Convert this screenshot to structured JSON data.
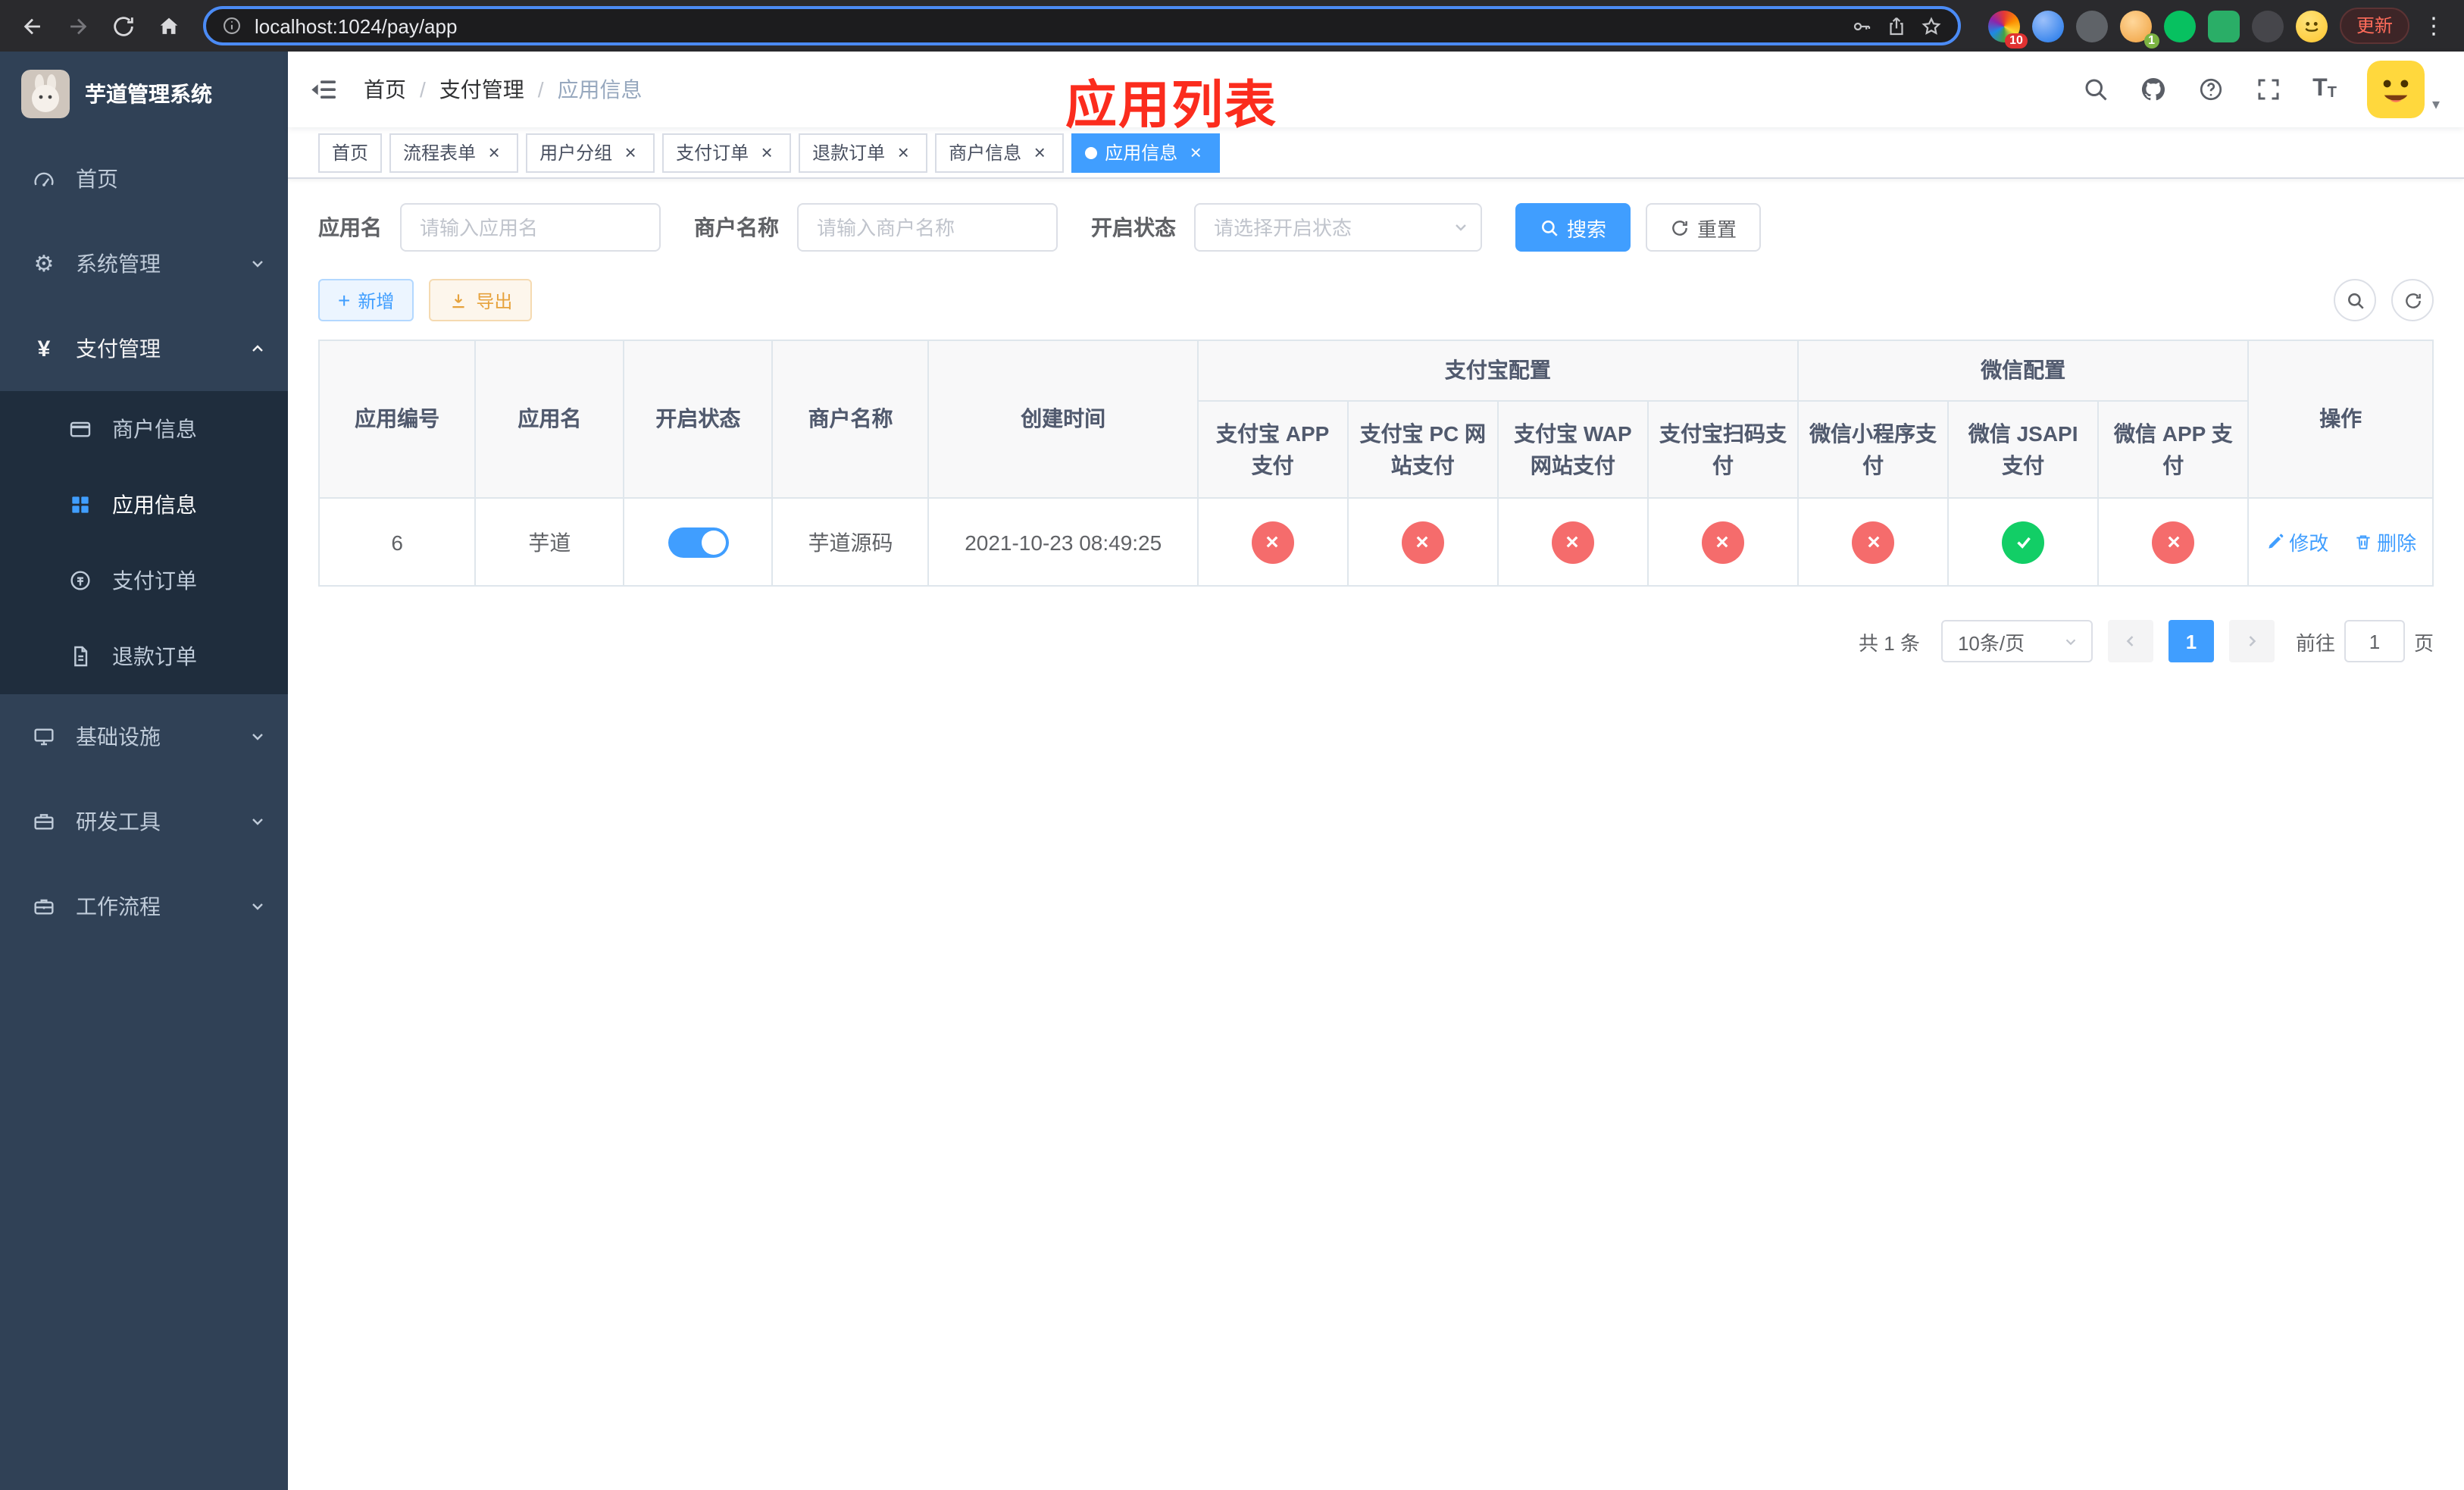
{
  "colors": {
    "primary": "#409eff",
    "success": "#12ce66",
    "danger": "#f56c6c",
    "warning": "#e6a23c",
    "sidebar_bg": "#304156",
    "submenu_bg": "#1f2d3d",
    "title_red": "#fb2c1d"
  },
  "icons": {
    "close": "×",
    "gear": "⚙",
    "yen": "¥",
    "plus": "+",
    "kebab": "⋮",
    "caret": "▾",
    "font_large": "T",
    "font_small": "T"
  },
  "browser": {
    "url": "localhost:1024/pay/app",
    "update_label": "更新",
    "ext_badge_notifications": "10",
    "ext_badge_avatar": "1"
  },
  "sidebar": {
    "title": "芋道管理系统",
    "items": {
      "home": "首页",
      "system": "系统管理",
      "payment": "支付管理",
      "infra": "基础设施",
      "devtools": "研发工具",
      "workflow": "工作流程"
    },
    "payment_children": {
      "merchant": "商户信息",
      "app": "应用信息",
      "order": "支付订单",
      "refund": "退款订单"
    }
  },
  "navbar": {
    "breadcrumb": [
      "首页",
      "支付管理",
      "应用信息"
    ],
    "separator": "/"
  },
  "page_title": "应用列表",
  "tags": [
    {
      "label": "首页",
      "closable": false,
      "active": false
    },
    {
      "label": "流程表单",
      "closable": true,
      "active": false
    },
    {
      "label": "用户分组",
      "closable": true,
      "active": false
    },
    {
      "label": "支付订单",
      "closable": true,
      "active": false
    },
    {
      "label": "退款订单",
      "closable": true,
      "active": false
    },
    {
      "label": "商户信息",
      "closable": true,
      "active": false
    },
    {
      "label": "应用信息",
      "closable": true,
      "active": true
    }
  ],
  "filters": {
    "app_name_label": "应用名",
    "app_name_placeholder": "请输入应用名",
    "merchant_label": "商户名称",
    "merchant_placeholder": "请输入商户名称",
    "status_label": "开启状态",
    "status_placeholder": "请选择开启状态",
    "search_label": "搜索",
    "reset_label": "重置"
  },
  "toolbar": {
    "add_label": "新增",
    "export_label": "导出"
  },
  "table": {
    "headers": {
      "app_id": "应用编号",
      "app_name": "应用名",
      "status": "开启状态",
      "merchant": "商户名称",
      "create_time": "创建时间",
      "group_alipay": "支付宝配置",
      "group_wechat": "微信配置",
      "alipay_app": "支付宝 APP 支付",
      "alipay_pc": "支付宝 PC 网站支付",
      "alipay_wap": "支付宝 WAP 网站支付",
      "alipay_scan": "支付宝扫码支付",
      "wechat_lite": "微信小程序支付",
      "wechat_jsapi": "微信 JSAPI 支付",
      "wechat_app": "微信 APP 支付",
      "actions": "操作"
    },
    "row": {
      "app_id": "6",
      "app_name": "芋道",
      "status_on": true,
      "merchant_name": "芋道源码",
      "create_time": "2021-10-23 08:49:25",
      "configs": {
        "alipay_app": false,
        "alipay_pc": false,
        "alipay_wap": false,
        "alipay_scan": false,
        "wechat_lite": false,
        "wechat_jsapi": true,
        "wechat_app": false
      }
    },
    "edit_label": "修改",
    "delete_label": "删除"
  },
  "pagination": {
    "total_text": "共 1 条",
    "page_size_text": "10条/页",
    "current_page": "1",
    "goto_label": "前往",
    "jump_value": "1",
    "page_unit_label": "页"
  }
}
